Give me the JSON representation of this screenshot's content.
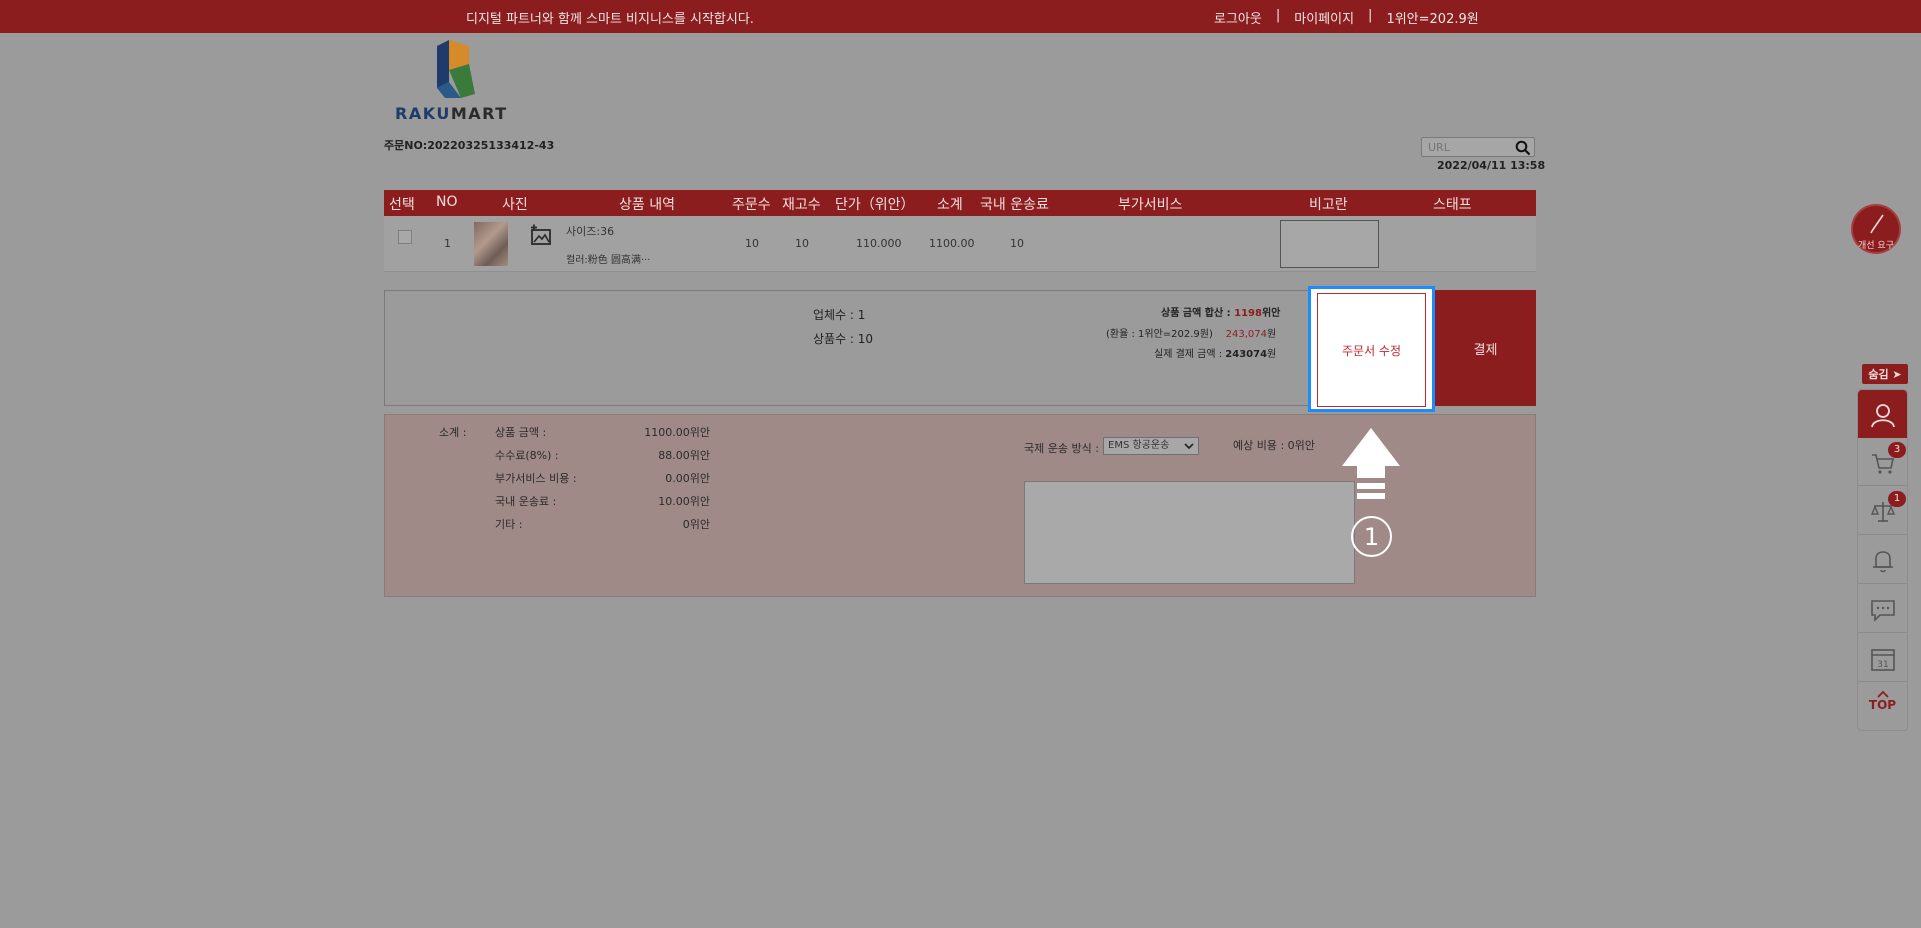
{
  "topbar": {
    "message": "디지털 파트너와 함께 스마트 비지니스를 시작합시다.",
    "logout": "로그아웃",
    "sep1": "|",
    "mypage": "마이페이지",
    "sep2": "|",
    "rate": "1위안=202.9원"
  },
  "logo": {
    "part1": "RAKU",
    "part2": "MART"
  },
  "order": {
    "number": "주문NO:20220325133412-43",
    "datetime": "2022/04/11 13:58"
  },
  "search": {
    "placeholder": "URL",
    "icon": "search-icon"
  },
  "table": {
    "headers": [
      "선택",
      "NO",
      "사진",
      "상품 내역",
      "주문수",
      "재고수",
      "단가（위안）",
      "소계",
      "국내 운송료",
      "부가서비스",
      "비고란",
      "스태프"
    ],
    "row": {
      "no": "1",
      "size": "사이즈:36",
      "color": "컬러:粉色 圆高满···",
      "order_qty": "10",
      "stock_qty": "10",
      "unit_price": "110.000",
      "subtotal": "1100.00",
      "domestic_ship": "10"
    }
  },
  "summary": {
    "vendors": "업체수 : 1",
    "products": "상품수 : 10",
    "total_label": "상품 금액 합산 :",
    "total_value": "1198",
    "total_unit": "위안",
    "exchange_label": "(환율 : 1위안=202.9원)",
    "exchange_value": "243,074",
    "exchange_unit": "원",
    "actual_label": "실제 결제 금액 :",
    "actual_value": "243074",
    "actual_unit": "원",
    "edit_button": "주문서 수정",
    "pay_button": "결제"
  },
  "details": {
    "subtotal_label": "소계 :",
    "items": [
      {
        "label": "상품 금액 :",
        "value": "1100.00위안"
      },
      {
        "label": "수수료(8%) :",
        "value": "88.00위안"
      },
      {
        "label": "부가서비스 비용 :",
        "value": "0.00위안"
      },
      {
        "label": "국내 운송료 :",
        "value": "10.00위안"
      },
      {
        "label": "기타 :",
        "value": "0위안"
      }
    ],
    "shipping_label": "국제 운송 방식 :",
    "shipping_value": "EMS 항공운송",
    "estimate": "예상 비용 : 0위안"
  },
  "annotation": {
    "step": "1"
  },
  "side": {
    "fab_label": "개선 요구",
    "hide_label": "숨김 ➤",
    "cart_badge": "3",
    "compare_badge": "1",
    "calendar_day": "31",
    "top_label": "TOP"
  },
  "colors": {
    "brand": "#8c1d1f",
    "highlight": "#1a8cff",
    "edit": "#c0282c"
  }
}
